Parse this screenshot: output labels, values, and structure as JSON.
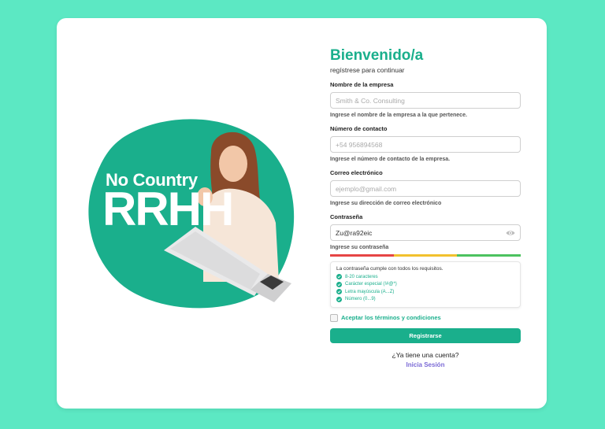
{
  "brand": {
    "line1": "No Country",
    "line2": "RRHH"
  },
  "form": {
    "title": "Bienvenido/a",
    "subtitle": "regístrese para continuar",
    "company": {
      "label": "Nombre de la empresa",
      "placeholder": "Smith & Co. Consulting",
      "helper": "Ingrese el nombre de la empresa a la que pertenece."
    },
    "contact": {
      "label": "Número de contacto",
      "placeholder": "+54 956894568",
      "helper": "Ingrese el número de contacto de la empresa."
    },
    "email": {
      "label": "Correo electrónico",
      "placeholder": "ejemplo@gmail.com",
      "helper": "Ingrese su dirección de correo electrónico"
    },
    "password": {
      "label": "Contraseña",
      "value": "Zu@ra92eic",
      "helper": "Ingrese su contraseña",
      "toggle_icon": "eye-icon"
    },
    "strength_colors": [
      "#e64545",
      "#f2c12e",
      "#4cc25f"
    ],
    "requirements": {
      "title": "La contraseña cumple con todos los requisitos.",
      "items": [
        "8-20 caracteres",
        "Carácter especial (!#@*)",
        "Letra mayúscula (A...Z)",
        "Número (0...9)"
      ]
    },
    "terms_label": "Aceptar los términos y condiciones",
    "submit_label": "Registrarse",
    "have_account": "¿Ya tiene una cuenta?",
    "login_link": "Inicia Sesión"
  },
  "colors": {
    "background": "#5ce8c3",
    "accent": "#1aaf8c",
    "link": "#7b6ad6"
  }
}
